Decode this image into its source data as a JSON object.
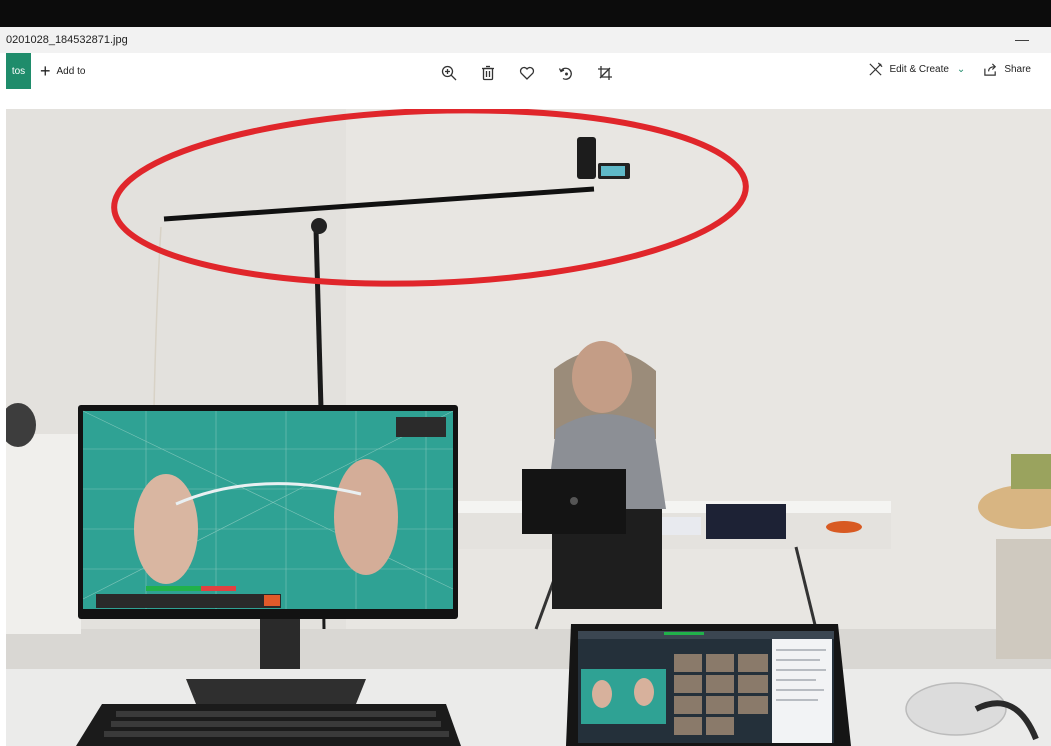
{
  "window": {
    "filename": "0201028_184532871.jpg",
    "minimize_glyph": "—"
  },
  "toolbar": {
    "app_tab_label": "tos",
    "add_to_label": "Add to",
    "center_tools": [
      "zoom-in-icon",
      "delete-icon",
      "favorite-icon",
      "rotate-icon",
      "crop-icon"
    ],
    "edit_create_label": "Edit & Create",
    "share_label": "Share"
  },
  "colors": {
    "accent": "#1f8c6b",
    "annotation_red": "#e0262b",
    "cutting_mat": "#2fa294",
    "topbar": "#0c0c0c"
  }
}
